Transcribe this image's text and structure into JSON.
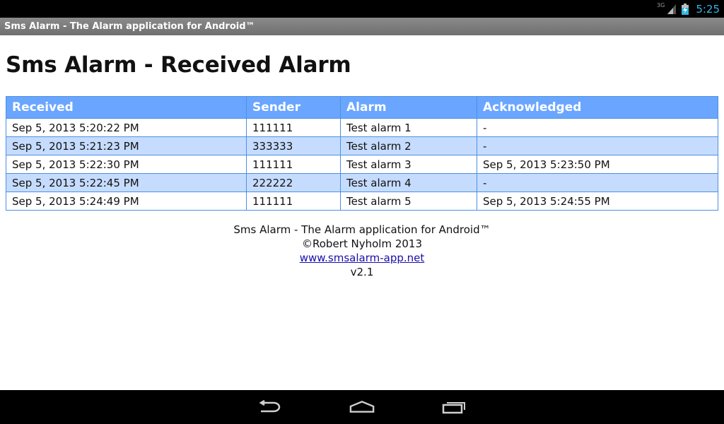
{
  "status_bar": {
    "network": "3G",
    "time": "5:25",
    "icons": [
      "signal-icon",
      "battery-charging-icon"
    ],
    "accent_color": "#33b5e5"
  },
  "app_bar": {
    "title": "Sms Alarm - The Alarm application for Android™"
  },
  "page": {
    "heading": "Sms Alarm - Received Alarm"
  },
  "table": {
    "headers": [
      "Received",
      "Sender",
      "Alarm",
      "Acknowledged"
    ],
    "header_color": "#6aa6ff",
    "alt_row_color": "#c6dcff",
    "rows": [
      [
        "Sep 5, 2013 5:20:22 PM",
        "111111",
        "Test alarm 1",
        "-"
      ],
      [
        "Sep 5, 2013 5:21:23 PM",
        "333333",
        "Test alarm 2",
        "-"
      ],
      [
        "Sep 5, 2013 5:22:30 PM",
        "111111",
        "Test alarm 3",
        "Sep 5, 2013 5:23:50 PM"
      ],
      [
        "Sep 5, 2013 5:22:45 PM",
        "222222",
        "Test alarm 4",
        "-"
      ],
      [
        "Sep 5, 2013 5:24:49 PM",
        "111111",
        "Test alarm 5",
        "Sep 5, 2013 5:24:55 PM"
      ]
    ]
  },
  "footer": {
    "app_name": "Sms Alarm - The Alarm application for Android™",
    "copyright": "©Robert Nyholm 2013",
    "link_text": "www.smsalarm-app.net",
    "version": "v2.1"
  },
  "nav_bar": {
    "buttons": [
      "back-icon",
      "home-icon",
      "recent-apps-icon"
    ]
  }
}
